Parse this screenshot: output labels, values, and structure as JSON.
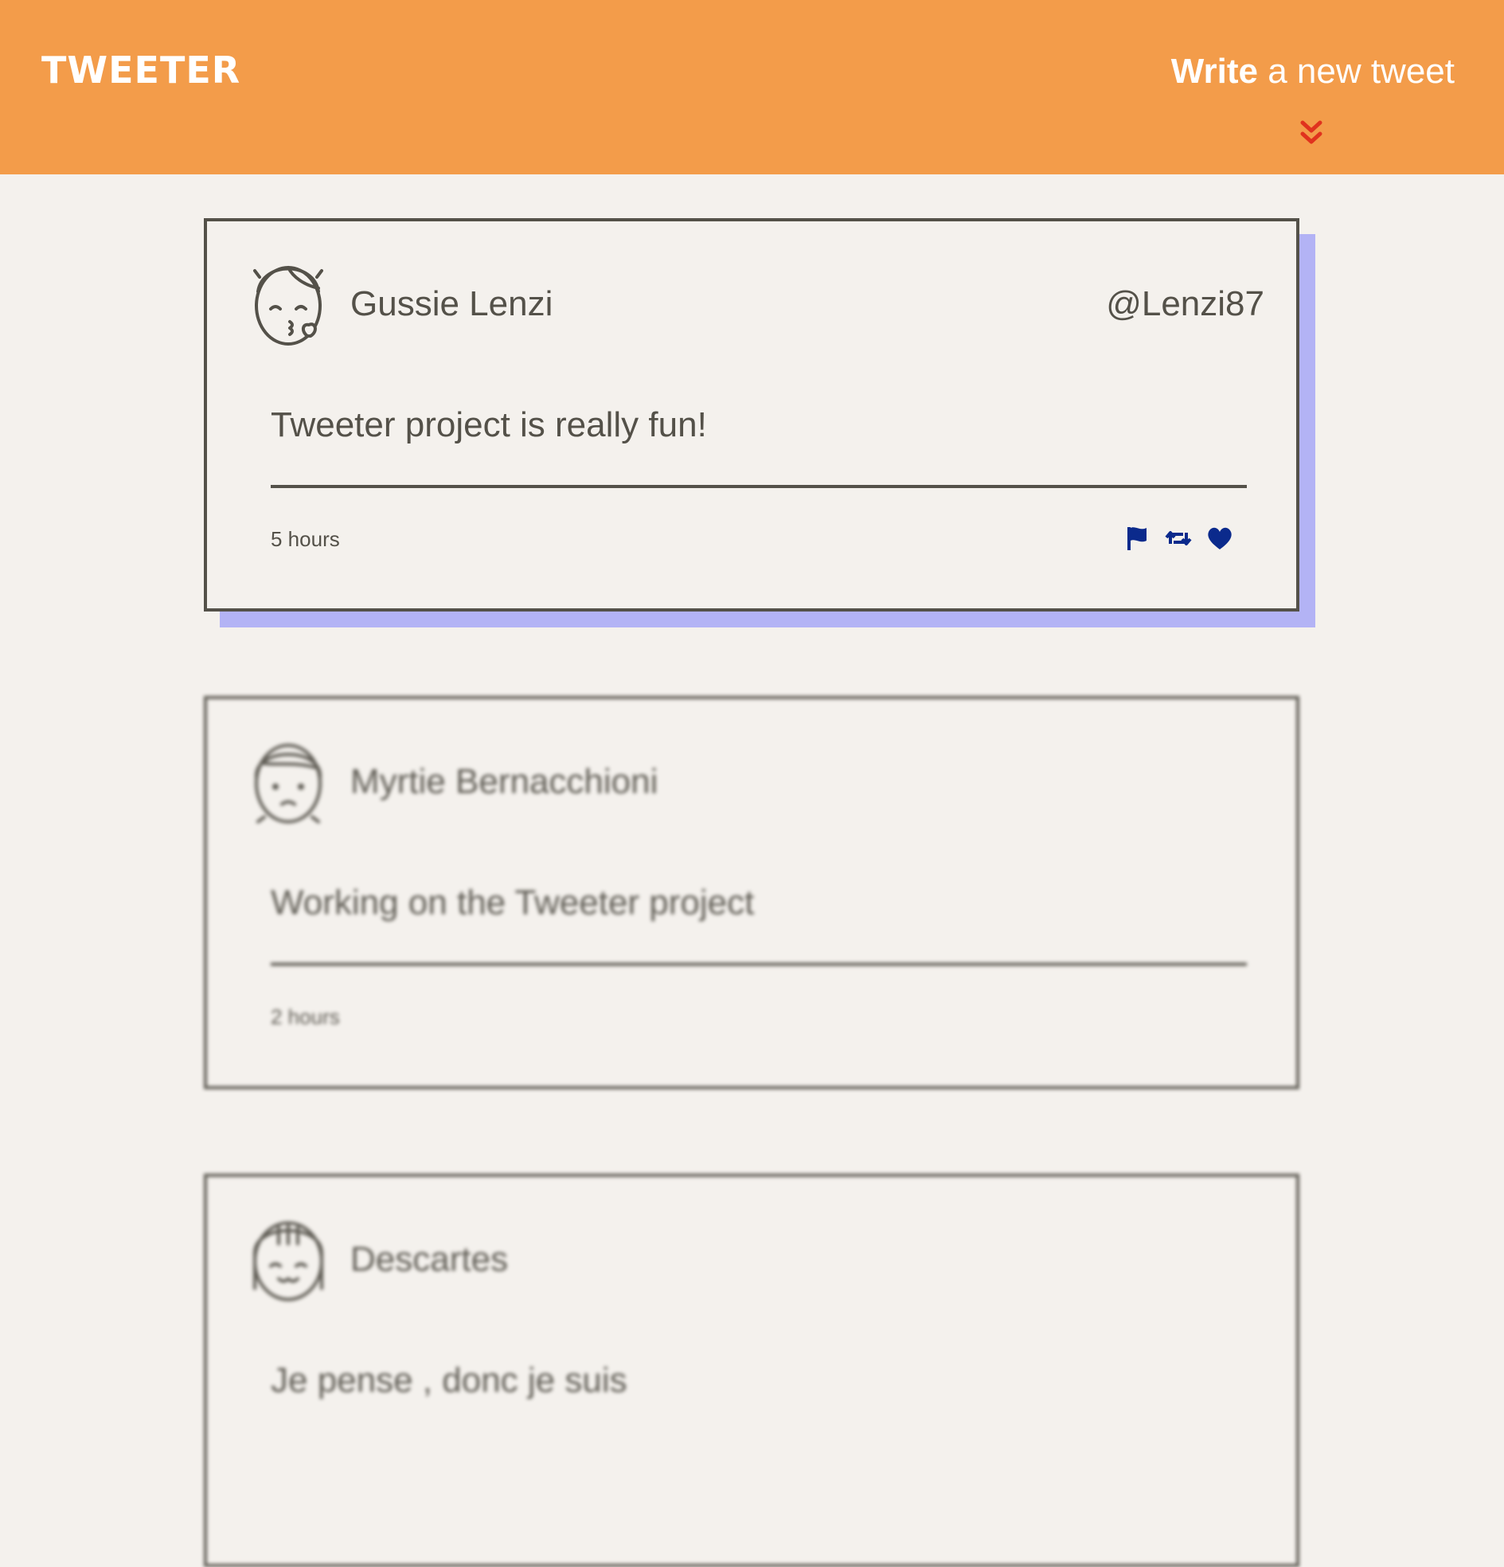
{
  "nav": {
    "logo": "TWEETER",
    "compose_strong": "Write",
    "compose_rest": " a new tweet"
  },
  "tweets": [
    {
      "name": "Gussie Lenzi",
      "handle": "@Lenzi87",
      "text": "Tweeter project is really fun!",
      "time": "5 hours"
    },
    {
      "name": "Myrtie Bernacchioni",
      "handle": "",
      "text": "Working on the Tweeter project",
      "time": "2 hours"
    },
    {
      "name": "Descartes",
      "handle": "",
      "text": "Je pense , donc je suis",
      "time": ""
    }
  ],
  "colors": {
    "header": "#f39c4a",
    "page": "#f4f1ed",
    "border": "#545149",
    "shadow": "#b3b3f5",
    "action_icons": "#0b2a8c",
    "toggle_arrow": "#e0321e"
  },
  "icons": {
    "toggle": "double-chevron-down-icon",
    "flag": "flag-icon",
    "retweet": "retweet-icon",
    "like": "heart-icon"
  }
}
